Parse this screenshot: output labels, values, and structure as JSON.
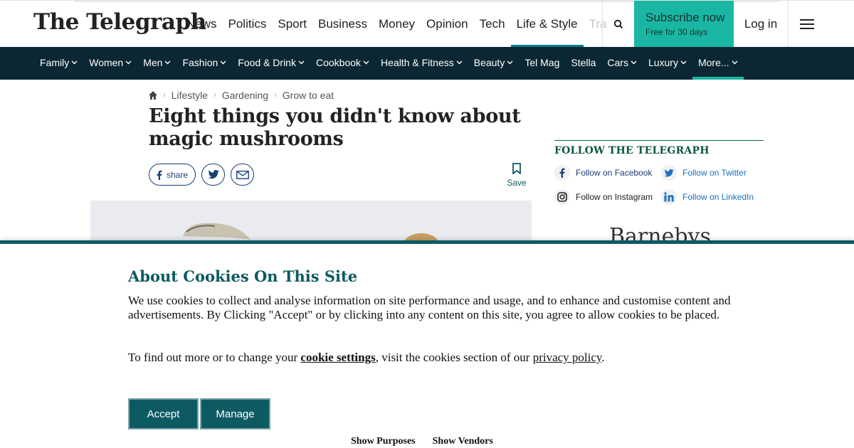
{
  "header": {
    "logo": "The Telegraph",
    "nav": [
      "News",
      "Politics",
      "Sport",
      "Business",
      "Money",
      "Opinion",
      "Tech",
      "Life & Style",
      "Tra"
    ],
    "active_nav": "Life & Style",
    "subscribe_label": "Subscribe now",
    "subscribe_sub": "Free for 30 days",
    "login_label": "Log in"
  },
  "subnav": {
    "items": [
      {
        "label": "Family",
        "chevron": true
      },
      {
        "label": "Women",
        "chevron": true
      },
      {
        "label": "Men",
        "chevron": true
      },
      {
        "label": "Fashion",
        "chevron": true
      },
      {
        "label": "Food & Drink",
        "chevron": true
      },
      {
        "label": "Cookbook",
        "chevron": true
      },
      {
        "label": "Health & Fitness",
        "chevron": true
      },
      {
        "label": "Beauty",
        "chevron": true
      },
      {
        "label": "Tel Mag",
        "chevron": false
      },
      {
        "label": "Stella",
        "chevron": false
      },
      {
        "label": "Cars",
        "chevron": true
      },
      {
        "label": "Luxury",
        "chevron": true
      },
      {
        "label": "More...",
        "chevron": true,
        "active": true
      }
    ]
  },
  "article": {
    "breadcrumb": [
      "Lifestyle",
      "Gardening",
      "Grow to eat"
    ],
    "title": "Eight things you didn't know about magic mushrooms",
    "share_label": "share",
    "save_label": "Save"
  },
  "sidebar": {
    "follow_heading": "FOLLOW THE TELEGRAPH",
    "links": [
      {
        "label": "Follow on Facebook",
        "icon": "facebook-icon"
      },
      {
        "label": "Follow on Twitter",
        "icon": "twitter-icon"
      },
      {
        "label": "Follow on Instagram",
        "icon": "instagram-icon"
      },
      {
        "label": "Follow on LinkedIn",
        "icon": "linkedin-icon"
      }
    ],
    "advert_text": "Barnebys"
  },
  "cookie": {
    "heading": "About Cookies On This Site",
    "body": "We use cookies to collect and analyse information on site performance and usage, and to enhance and customise content and advertisements. By Clicking \"Accept\" or by clicking into any content on this site, you agree to allow cookies to be placed.",
    "p2_prefix": "To find out more or to change your ",
    "p2_settings_link": "cookie settings",
    "p2_middle": ", visit the cookies section of our ",
    "p2_policy_link": "privacy policy",
    "p2_suffix": ".",
    "accept_label": "Accept",
    "manage_label": "Manage",
    "show_purposes": "Show Purposes",
    "show_vendors": "Show Vendors"
  },
  "colors": {
    "brand_teal": "#0d5a63",
    "nav_dark": "#0b2733",
    "subscribe": "#19b7a3"
  }
}
